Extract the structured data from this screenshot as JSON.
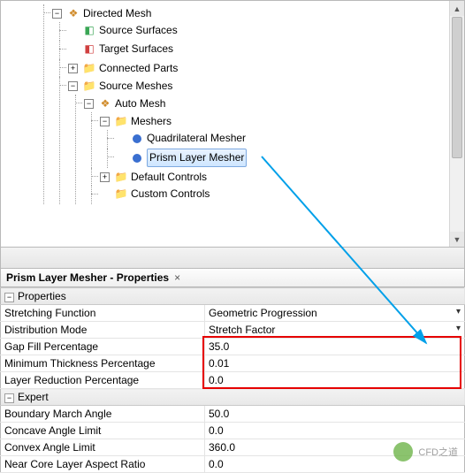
{
  "tree": {
    "root": "Directed Mesh",
    "source_surfaces": "Source Surfaces",
    "target_surfaces": "Target Surfaces",
    "connected_parts": "Connected Parts",
    "source_meshes": "Source Meshes",
    "auto_mesh": "Auto Mesh",
    "meshers": "Meshers",
    "quad_mesher": "Quadrilateral Mesher",
    "prism_mesher": "Prism Layer Mesher",
    "default_controls": "Default Controls",
    "custom_controls": "Custom Controls"
  },
  "panel": {
    "title": "Prism Layer Mesher - Properties"
  },
  "sections": {
    "properties": "Properties",
    "expert": "Expert"
  },
  "props": {
    "stretching_function": {
      "label": "Stretching Function",
      "value": "Geometric Progression"
    },
    "distribution_mode": {
      "label": "Distribution Mode",
      "value": "Stretch Factor"
    },
    "gap_fill": {
      "label": "Gap Fill Percentage",
      "value": "35.0"
    },
    "min_thickness": {
      "label": "Minimum Thickness Percentage",
      "value": "0.01"
    },
    "layer_reduction": {
      "label": "Layer Reduction Percentage",
      "value": "0.0"
    },
    "boundary_march": {
      "label": "Boundary March Angle",
      "value": "50.0"
    },
    "concave_limit": {
      "label": "Concave Angle Limit",
      "value": "0.0"
    },
    "convex_limit": {
      "label": "Convex Angle Limit",
      "value": "360.0"
    },
    "near_core_ratio": {
      "label": "Near Core Layer Aspect Ratio",
      "value": "0.0"
    }
  },
  "watermark": "CFD之道"
}
